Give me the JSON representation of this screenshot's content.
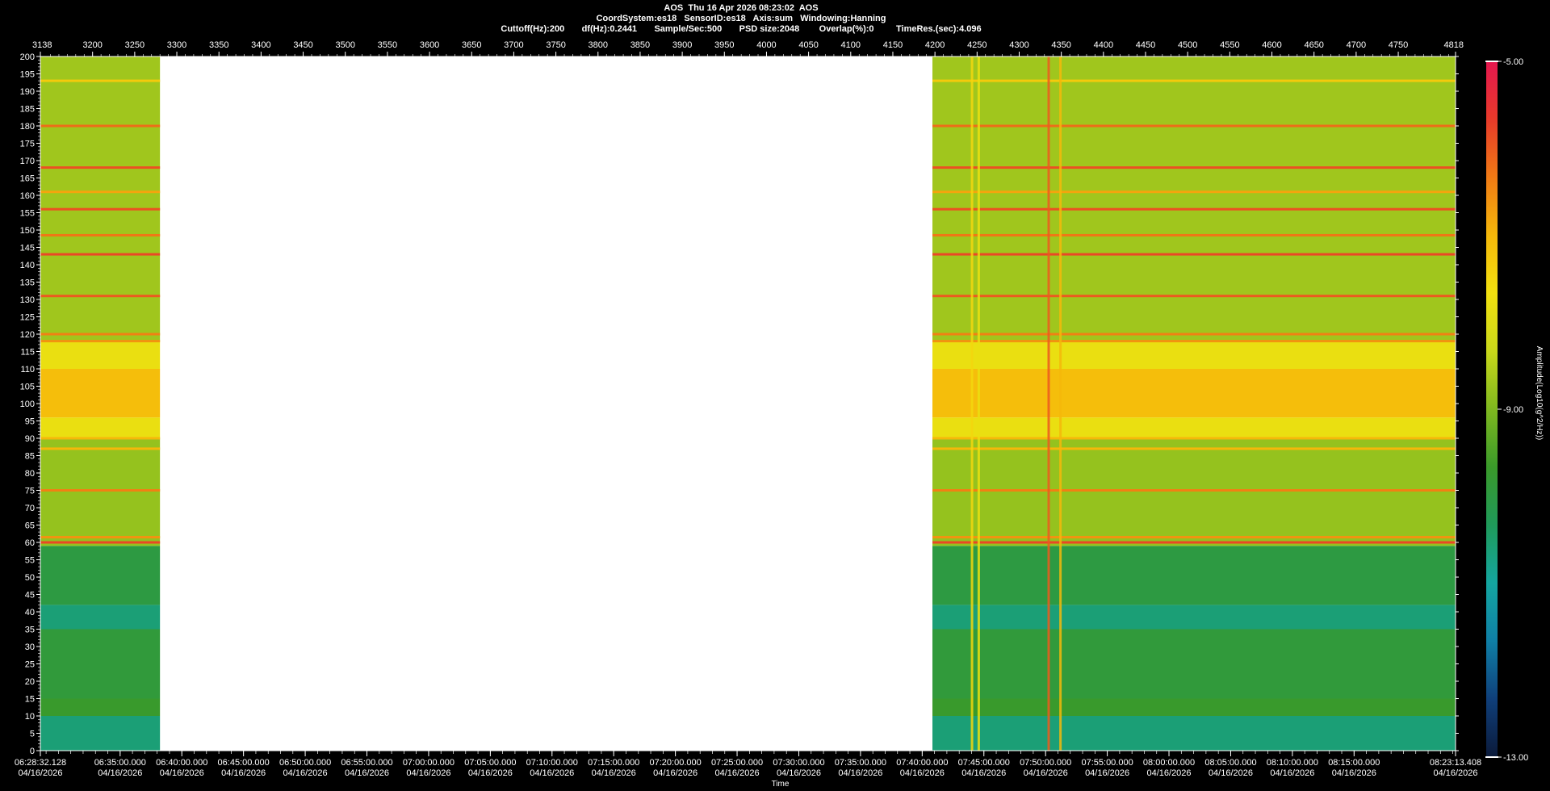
{
  "header": {
    "line1": "AOS  Thu 16 Apr 2026 08:23:02  AOS",
    "line2": "CoordSystem:es18   SensorID:es18   Axis:sum   Windowing:Hanning",
    "line3": "Cuttoff(Hz):200       df(Hz):0.2441       Sample/Sec:500       PSD size:2048        Overlap(%):0         TimeRes.(sec):4.096"
  },
  "colorbar": {
    "label": "Amplitude(Log10(g^2/Hz))",
    "ticks": [
      "-5.00",
      "-9.00",
      "-13.00"
    ],
    "min": -13,
    "max": -5,
    "stops": [
      "#0b1a3a",
      "#0f3f7a",
      "#0f7fa6",
      "#14a6a0",
      "#1f9a5a",
      "#3a9a2a",
      "#7fb81f",
      "#c9d81a",
      "#f2e10f",
      "#f5b80a",
      "#f07a14",
      "#e83a2a",
      "#e5174f"
    ]
  },
  "chart_data": {
    "type": "heatmap",
    "title": "AOS  Thu 16 Apr 2026 08:23:02  AOS",
    "xlabel": "Time",
    "ylabel": "",
    "ylim": [
      0,
      200
    ],
    "top_axis_range": [
      3138,
      4818
    ],
    "top_axis_ticks": [
      "3138",
      "3200",
      "3250",
      "3300",
      "3350",
      "3400",
      "3450",
      "3500",
      "3550",
      "3600",
      "3650",
      "3700",
      "3750",
      "3800",
      "3850",
      "3900",
      "3950",
      "4000",
      "4050",
      "4100",
      "4150",
      "4200",
      "4250",
      "4300",
      "4350",
      "4400",
      "4450",
      "4500",
      "4550",
      "4600",
      "4650",
      "4700",
      "4750",
      "4818"
    ],
    "y_ticks": [
      0,
      5,
      10,
      15,
      20,
      25,
      30,
      35,
      40,
      45,
      50,
      55,
      60,
      65,
      70,
      75,
      80,
      85,
      90,
      95,
      100,
      105,
      110,
      115,
      120,
      125,
      130,
      135,
      140,
      145,
      150,
      155,
      160,
      165,
      170,
      175,
      180,
      185,
      190,
      195,
      200
    ],
    "time_ticks": [
      {
        "time": "06:28:32.128",
        "date": "04/16/2026"
      },
      {
        "time": "06:35:00.000",
        "date": "04/16/2026"
      },
      {
        "time": "06:40:00.000",
        "date": "04/16/2026"
      },
      {
        "time": "06:45:00.000",
        "date": "04/16/2026"
      },
      {
        "time": "06:50:00.000",
        "date": "04/16/2026"
      },
      {
        "time": "06:55:00.000",
        "date": "04/16/2026"
      },
      {
        "time": "07:00:00.000",
        "date": "04/16/2026"
      },
      {
        "time": "07:05:00.000",
        "date": "04/16/2026"
      },
      {
        "time": "07:10:00.000",
        "date": "04/16/2026"
      },
      {
        "time": "07:15:00.000",
        "date": "04/16/2026"
      },
      {
        "time": "07:20:00.000",
        "date": "04/16/2026"
      },
      {
        "time": "07:25:00.000",
        "date": "04/16/2026"
      },
      {
        "time": "07:30:00.000",
        "date": "04/16/2026"
      },
      {
        "time": "07:35:00.000",
        "date": "04/16/2026"
      },
      {
        "time": "07:40:00.000",
        "date": "04/16/2026"
      },
      {
        "time": "07:45:00.000",
        "date": "04/16/2026"
      },
      {
        "time": "07:50:00.000",
        "date": "04/16/2026"
      },
      {
        "time": "07:55:00.000",
        "date": "04/16/2026"
      },
      {
        "time": "08:00:00.000",
        "date": "04/16/2026"
      },
      {
        "time": "08:05:00.000",
        "date": "04/16/2026"
      },
      {
        "time": "08:10:00.000",
        "date": "04/16/2026"
      },
      {
        "time": "08:15:00.000",
        "date": "04/16/2026"
      },
      {
        "time": "08:23:13.408",
        "date": "04/16/2026"
      }
    ],
    "data_segments": [
      {
        "start": 3138,
        "end": 3280
      },
      {
        "start": 4197,
        "end": 4818
      }
    ],
    "blank_range": [
      3280,
      4197
    ],
    "background_bands": [
      {
        "from": 0,
        "to": 10,
        "level": -10.6
      },
      {
        "from": 10,
        "to": 15,
        "level": -9.7
      },
      {
        "from": 15,
        "to": 35,
        "level": -9.9
      },
      {
        "from": 35,
        "to": 42,
        "level": -10.6
      },
      {
        "from": 42,
        "to": 59,
        "level": -10.0
      },
      {
        "from": 59,
        "to": 90,
        "level": -8.8
      },
      {
        "from": 90,
        "to": 96,
        "level": -7.8
      },
      {
        "from": 96,
        "to": 110,
        "level": -7.1
      },
      {
        "from": 110,
        "to": 118,
        "level": -7.8
      },
      {
        "from": 118,
        "to": 200,
        "level": -8.7
      }
    ],
    "tonal_lines": [
      {
        "freq": 60,
        "level": -5.8
      },
      {
        "freq": 61.5,
        "level": -6.6
      },
      {
        "freq": 75,
        "level": -6.4
      },
      {
        "freq": 87,
        "level": -7.0
      },
      {
        "freq": 90,
        "level": -7.0
      },
      {
        "freq": 118,
        "level": -6.6
      },
      {
        "freq": 120,
        "level": -6.4
      },
      {
        "freq": 131,
        "level": -6.0
      },
      {
        "freq": 143,
        "level": -5.8
      },
      {
        "freq": 148.5,
        "level": -6.3
      },
      {
        "freq": 156,
        "level": -5.9
      },
      {
        "freq": 161,
        "level": -6.8
      },
      {
        "freq": 168,
        "level": -5.9
      },
      {
        "freq": 180,
        "level": -6.2
      },
      {
        "freq": 193,
        "level": -7.3
      }
    ],
    "transient_lines": [
      {
        "x": 4335,
        "level": -6.0
      },
      {
        "x": 4349,
        "level": -7.0
      },
      {
        "x": 4244,
        "level": -7.5
      },
      {
        "x": 4252,
        "level": -7.8
      }
    ]
  }
}
